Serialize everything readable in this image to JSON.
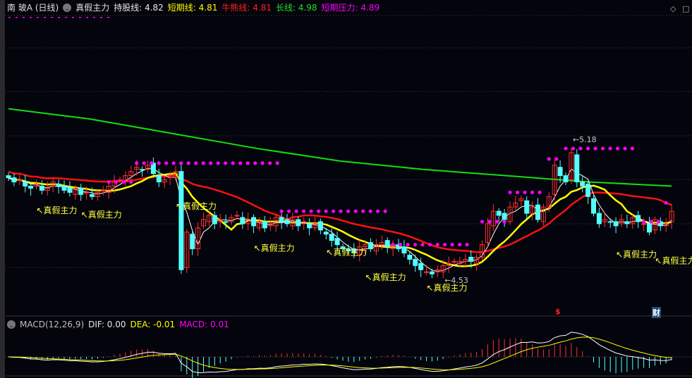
{
  "header": {
    "stock": "南 玻A (日线)",
    "indicator": "真假主力",
    "items": [
      {
        "label": "持股线: 4.82",
        "color": "#e8e8e8"
      },
      {
        "label": "短期线: 4.81",
        "color": "#ffff00"
      },
      {
        "label": "牛熊线: 4.81",
        "color": "#ff2020"
      },
      {
        "label": "长线: 4.98",
        "color": "#20e020"
      },
      {
        "label": "短期压力: 4.89",
        "color": "#ff00ff"
      }
    ]
  },
  "macd_header": {
    "title": "MACD(12,26,9)",
    "dif": "DIF: 0.00",
    "dea": "DEA: -0.01",
    "macd": "MACD: 0.01"
  },
  "markers": {
    "dividend": "$",
    "finance": "财"
  },
  "colors": {
    "up": "#ff3030",
    "down": "#54ffff",
    "ma_short": "#ffffff",
    "ma_mid": "#ffff00",
    "ma_long": "#ff1010",
    "long_line": "#10e010",
    "pressure": "#ff00ff",
    "bg": "#04040c"
  },
  "chart_data": {
    "type": "candlestick",
    "close": [
      5.02,
      5.0,
      5.01,
      4.98,
      4.97,
      4.99,
      4.96,
      4.97,
      5.0,
      4.98,
      4.96,
      4.95,
      4.97,
      4.94,
      4.95,
      4.93,
      4.95,
      4.96,
      4.98,
      5.0,
      5.01,
      5.03,
      5.05,
      5.07,
      5.06,
      5.08,
      5.04,
      5.0,
      5.01,
      5.03,
      5.05,
      4.58,
      4.76,
      4.68,
      4.78,
      4.82,
      4.84,
      4.8,
      4.82,
      4.81,
      4.83,
      4.84,
      4.8,
      4.82,
      4.79,
      4.81,
      4.78,
      4.8,
      4.83,
      4.81,
      4.8,
      4.82,
      4.79,
      4.81,
      4.78,
      4.8,
      4.77,
      4.75,
      4.72,
      4.7,
      4.68,
      4.67,
      4.66,
      4.69,
      4.7,
      4.68,
      4.7,
      4.71,
      4.69,
      4.7,
      4.68,
      4.66,
      4.63,
      4.6,
      4.58,
      4.57,
      4.56,
      4.58,
      4.6,
      4.61,
      4.62,
      4.62,
      4.63,
      4.62,
      4.64,
      4.7,
      4.8,
      4.86,
      4.84,
      4.82,
      4.88,
      4.9,
      4.92,
      4.85,
      4.88,
      4.82,
      4.88,
      4.93,
      5.08,
      5.03,
      5.0,
      5.14,
      5.0,
      4.98,
      4.93,
      4.85,
      4.8,
      4.82,
      4.81,
      4.79,
      4.82,
      4.8,
      4.83,
      4.81,
      4.8,
      4.76,
      4.82,
      4.79,
      4.8,
      4.86
    ],
    "long_line": [
      5.35,
      5.3,
      5.23,
      5.16,
      5.1,
      5.06,
      5.03,
      5.0,
      4.98
    ],
    "pressure_segments": [
      {
        "from": 18,
        "to": 22,
        "price": 5.0
      },
      {
        "from": 23,
        "to": 49,
        "price": 5.09
      },
      {
        "from": 49,
        "to": 68,
        "price": 4.86
      },
      {
        "from": 69,
        "to": 83,
        "price": 4.7
      },
      {
        "from": 85,
        "to": 89,
        "price": 4.81
      },
      {
        "from": 90,
        "to": 96,
        "price": 4.95
      },
      {
        "from": 97,
        "to": 99,
        "price": 5.11
      },
      {
        "from": 100,
        "to": 113,
        "price": 5.16
      },
      {
        "from": 114,
        "to": 117,
        "price": 4.81
      },
      {
        "from": 118,
        "to": 119,
        "price": 4.9
      }
    ],
    "annotations": [
      {
        "bar": 5,
        "price": 4.85,
        "text": "真假主力"
      },
      {
        "bar": 13,
        "price": 4.83,
        "text": "真假主力"
      },
      {
        "bar": 30,
        "price": 4.87,
        "text": "真假主力"
      },
      {
        "bar": 44,
        "price": 4.67,
        "text": "真假主力"
      },
      {
        "bar": 57,
        "price": 4.65,
        "text": "真假主力"
      },
      {
        "bar": 64,
        "price": 4.53,
        "text": "真假主力"
      },
      {
        "bar": 75,
        "price": 4.48,
        "text": "真假主力"
      },
      {
        "bar": 109,
        "price": 4.64,
        "text": "真假主力"
      },
      {
        "bar": 116,
        "price": 4.61,
        "text": "真假主力"
      }
    ],
    "high_label": {
      "bar": 101,
      "price": 5.18,
      "text": "5.18"
    },
    "low_label": {
      "bar": 78,
      "price": 4.53,
      "text": "4.53"
    },
    "ylim": [
      4.39,
      5.77
    ]
  }
}
